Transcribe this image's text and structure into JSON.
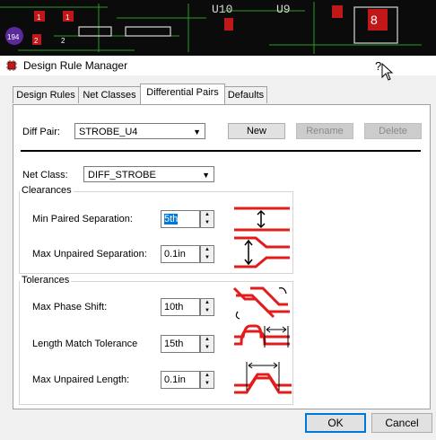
{
  "pcb": {
    "labels": [
      "194",
      "U10",
      "U9",
      "8",
      "1",
      "2",
      "1",
      "2"
    ]
  },
  "window": {
    "title": "Design Rule Manager",
    "help": "?"
  },
  "tabs": [
    {
      "label": "Design Rules"
    },
    {
      "label": "Net Classes"
    },
    {
      "label": "Differential Pairs"
    },
    {
      "label": "Defaults"
    }
  ],
  "diff_pair": {
    "label": "Diff Pair:",
    "value": "STROBE_U4"
  },
  "buttons": {
    "new": "New",
    "rename": "Rename",
    "delete": "Delete",
    "ok": "OK",
    "cancel": "Cancel"
  },
  "net_class": {
    "label": "Net Class:",
    "value": "DIFF_STROBE"
  },
  "clearances": {
    "title": "Clearances",
    "min_paired": {
      "label": "Min Paired Separation:",
      "value": "5th"
    },
    "max_unpaired": {
      "label": "Max Unpaired Separation:",
      "value": "0.1in"
    }
  },
  "tolerances": {
    "title": "Tolerances",
    "phase_shift": {
      "label": "Max Phase Shift:",
      "value": "10th"
    },
    "length_match": {
      "label": "Length Match Tolerance",
      "value": "15th"
    },
    "unpaired_length": {
      "label": "Max Unpaired Length:",
      "value": "0.1in"
    }
  },
  "colors": {
    "trace": "#e21b1b",
    "accent": "#0078d7"
  }
}
